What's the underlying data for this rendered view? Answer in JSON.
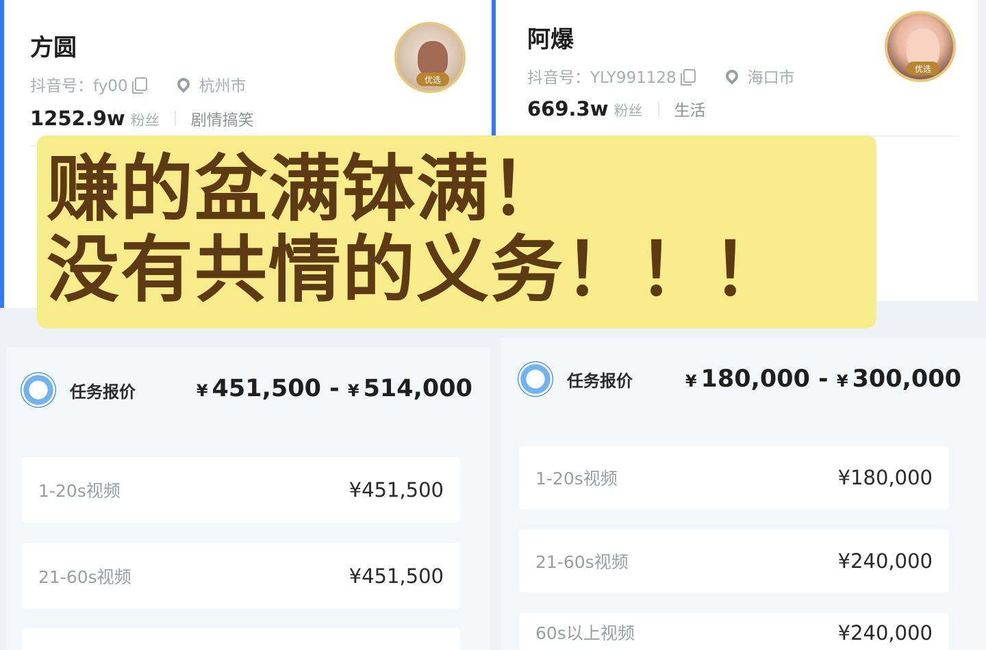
{
  "left_profile": {
    "name": "方圆",
    "douyin_id": "抖音号：fy00",
    "location": "杭州市",
    "fans": "1252.9w",
    "fans_unit": "粉丝",
    "category": "剧情搞笑",
    "avatar_badge": "优选"
  },
  "right_profile": {
    "name": "阿爆",
    "douyin_id": "抖音号：YLY991128",
    "location": "海口市",
    "fans": "669.3w",
    "fans_unit": "粉丝",
    "category": "生活",
    "avatar_badge": "优选"
  },
  "banner": {
    "line1": "赚的盆满钵满！",
    "line2": "没有共情的义务！！！"
  },
  "left_price": {
    "title": "任务报价",
    "coin_symbol": "¥",
    "range_low": "451,500",
    "range_high": "514,000",
    "range_separator": "-",
    "rows": [
      {
        "label": "1-20s视频",
        "value": "¥451,500"
      },
      {
        "label": "21-60s视频",
        "value": "¥451,500"
      }
    ]
  },
  "right_price": {
    "title": "任务报价",
    "coin_symbol": "¥",
    "range_low": "180,000",
    "range_high": "300,000",
    "range_separator": "-",
    "rows": [
      {
        "label": "1-20s视频",
        "value": "¥180,000"
      },
      {
        "label": "21-60s视频",
        "value": "¥240,000"
      },
      {
        "label": "60s以上视频",
        "value": "¥240,000"
      }
    ]
  },
  "colors": {
    "accent": "#2f7cf6",
    "banner_bg": "#f8ec8a",
    "banner_text": "#5c3a14"
  }
}
